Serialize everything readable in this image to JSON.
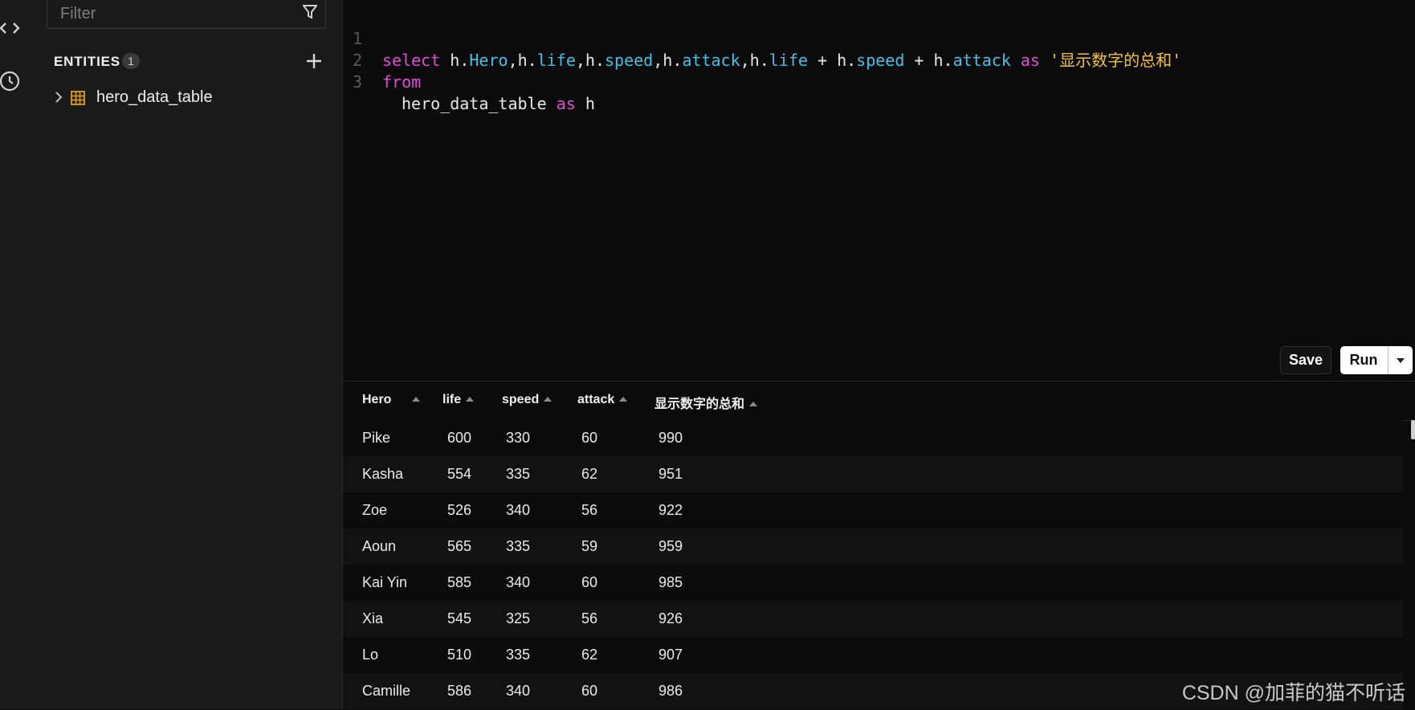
{
  "sidebar": {
    "filter_placeholder": "Filter",
    "entities_title": "ENTITIES",
    "entities_count": "1",
    "tables": [
      {
        "name": "hero_data_table"
      }
    ]
  },
  "editor": {
    "lines": [
      {
        "number": "1"
      },
      {
        "number": "2"
      },
      {
        "number": "3"
      }
    ],
    "tokens": {
      "select": "select",
      "h": "h",
      "dot": ".",
      "comma": ",",
      "plus": " + ",
      "hero": "Hero",
      "life": "life",
      "speed": "speed",
      "attack": "attack",
      "as": "as",
      "alias": "'显示数字的总和'",
      "from": "from",
      "table": "hero_data_table",
      "as2": "as",
      "alias_h": "h"
    }
  },
  "toolbar": {
    "save_label": "Save",
    "run_label": "Run"
  },
  "results": {
    "columns": [
      "Hero",
      "life",
      "speed",
      "attack",
      "显示数字的总和"
    ],
    "rows": [
      [
        "Pike",
        "600",
        "330",
        "60",
        "990"
      ],
      [
        "Kasha",
        "554",
        "335",
        "62",
        "951"
      ],
      [
        "Zoe",
        "526",
        "340",
        "56",
        "922"
      ],
      [
        "Aoun",
        "565",
        "335",
        "59",
        "959"
      ],
      [
        "Kai Yin",
        "585",
        "340",
        "60",
        "985"
      ],
      [
        "Xia",
        "545",
        "325",
        "56",
        "926"
      ],
      [
        "Lo",
        "510",
        "335",
        "62",
        "907"
      ],
      [
        "Camille",
        "586",
        "340",
        "60",
        "986"
      ]
    ]
  },
  "watermark": "CSDN @加菲的猫不听话"
}
